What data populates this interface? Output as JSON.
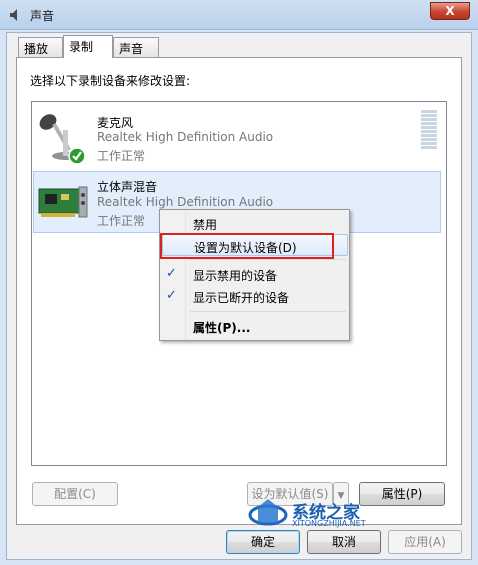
{
  "window": {
    "title": "声音",
    "close": "X"
  },
  "tabs": [
    {
      "label": "播放",
      "active": false
    },
    {
      "label": "录制",
      "active": true
    },
    {
      "label": "声音",
      "active": false
    }
  ],
  "instruction": "选择以下录制设备来修改设置:",
  "devices": [
    {
      "name": "麦克风",
      "driver": "Realtek High Definition Audio",
      "status": "工作正常",
      "icon": "microphone-icon",
      "default": true
    },
    {
      "name": "立体声混音",
      "driver": "Realtek High Definition Audio",
      "status": "工作正常",
      "icon": "sound-card-icon",
      "selected": true
    }
  ],
  "context_menu": {
    "items": [
      {
        "label": "禁用",
        "checked": false
      },
      {
        "label": "设置为默认设备(D)",
        "checked": false,
        "highlighted": true
      },
      {
        "label": "显示禁用的设备",
        "checked": true
      },
      {
        "label": "显示已断开的设备",
        "checked": true
      },
      {
        "label": "属性(P)...",
        "checked": false,
        "bold": true
      }
    ]
  },
  "panel_buttons": {
    "configure": "配置(C)",
    "set_default": "设为默认值(S)",
    "properties": "属性(P)"
  },
  "dialog_buttons": {
    "ok": "确定",
    "cancel": "取消",
    "apply": "应用(A)"
  },
  "watermark": {
    "text": "系统之家",
    "url": "XITONGZHIJIA.NET"
  },
  "colors": {
    "accent": "#1c4fb5",
    "highlight_box": "#e02020",
    "selected_row": "#e2eefb"
  }
}
